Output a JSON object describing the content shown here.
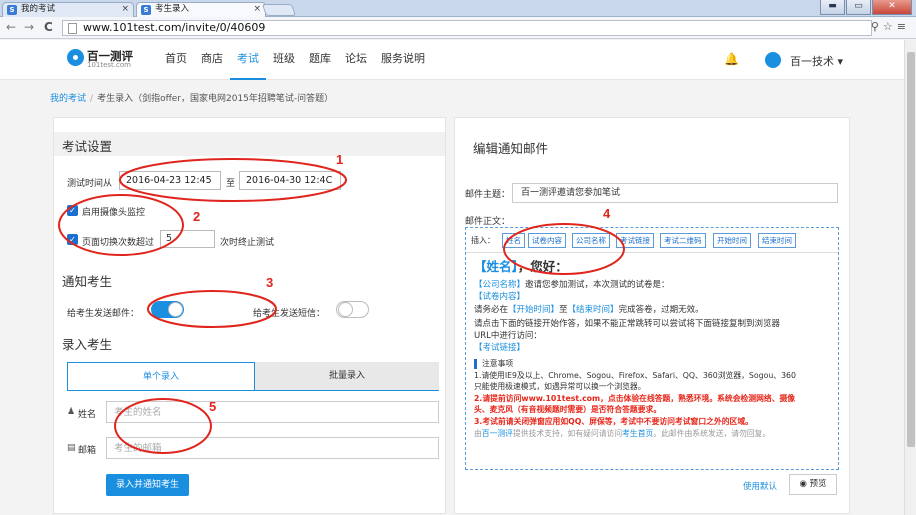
{
  "browser": {
    "tabs": [
      {
        "title": "我的考试",
        "close": "×"
      },
      {
        "title": "考生录入",
        "close": "×"
      }
    ],
    "url": "www.101test.com/invite/0/40609",
    "buttons": {
      "minimize": "▬",
      "maximize": "▭",
      "close": "✕"
    },
    "nav": {
      "back": "←",
      "forward": "→",
      "reload": "C"
    },
    "toolbar_icons": "⚲☆≡"
  },
  "header": {
    "logo_name": "百一测评",
    "logo_sub": "101test.com",
    "nav": [
      "首页",
      "商店",
      "考试",
      "班级",
      "题库",
      "论坛",
      "服务说明"
    ],
    "active_nav": "考试",
    "user": "百一技术 ▾",
    "bell": "🔔"
  },
  "breadcrumb": {
    "link": "我的考试",
    "sep": "/",
    "current": "考生录入（剑指offer，国家电网2015年招聘笔试-问答题）"
  },
  "exam_settings": {
    "title": "考试设置",
    "time_label": "测试时间从",
    "start": "2016-04-23 12:45",
    "to": "至",
    "end": "2016-04-30 12:4C",
    "camera_label": "启用摄像头监控",
    "switch_label": "页面切换次数超过",
    "switch_count": "5",
    "switch_suffix": "次时终止测试"
  },
  "notify": {
    "title": "通知考生",
    "email_label": "给考生发送邮件：",
    "sms_label": "给考生发送短信：",
    "email_on": true,
    "sms_on": false
  },
  "enroll": {
    "title": "录入考生",
    "tab_single": "单个录入",
    "tab_batch": "批量录入",
    "name_label": "姓名",
    "name_icon": "♟",
    "name_placeholder": "考生的姓名",
    "email_label": "邮箱",
    "email_icon": "▤",
    "email_placeholder": "考生的邮箱",
    "submit": "录入并通知考生"
  },
  "email_panel": {
    "title": "编辑通知邮件",
    "subject_label": "邮件主题：",
    "subject": "百一测评邀请您参加笔试",
    "body_label": "邮件正文：",
    "insert_label": "插入：",
    "tags": [
      "姓名",
      "试卷内容",
      "公司名称",
      "考试链接",
      "考试二维码",
      "开始时间",
      "结束时间"
    ],
    "body": {
      "greeting_name": "【姓名】",
      "greeting_rest": "，您好：",
      "l2_company": "【公司名称】",
      "l2_rest": "邀请您参加测试，本次测试的试卷是：",
      "l3": "【试卷内容】",
      "l4_pre": "请务必在",
      "l4_start": "【开始时间】",
      "l4_mid": "至",
      "l4_end": "【结束时间】",
      "l4_post": "完成答卷，过期无效。",
      "l5": "请点击下面的链接开始作答，如果不能正常跳转可以尝试将下面链接复制到浏览器",
      "l6": "URL中进行访问：",
      "l7": "【考试链接】"
    },
    "notes": {
      "title": "注意事项",
      "n1a": "1.请使用IE9及以上、Chrome、Sogou、Firefox、Safari、QQ、360浏览器，Sogou、360",
      "n1b": "只能使用极速模式，如遇异常可以换一个浏览器。",
      "n2a": "2.请提前访问www.101test.com，点击体验在线答题，熟悉环境。系统会检测网络、摄像",
      "n2b": "头、麦克风（有音视频题时需要）是否符合答题要求。",
      "n3": "3.考试前请关闭弹窗应用如QQ、屏保等，考试中不要访问考试窗口之外的区域。",
      "n4_pre": "由",
      "n4_link": "百一测评",
      "n4_mid": "提供技术支持，如有疑问请访问",
      "n4_link2": "考生首页",
      "n4_post": "。此邮件由系统发送，请勿回复。"
    },
    "use_default": "使用默认",
    "preview": "◉ 预览"
  },
  "annotations": [
    "1",
    "2",
    "3",
    "4",
    "5"
  ],
  "colors": {
    "accent": "#1a8fe0",
    "annotation": "#e0251d",
    "warning": "#e8261a"
  }
}
